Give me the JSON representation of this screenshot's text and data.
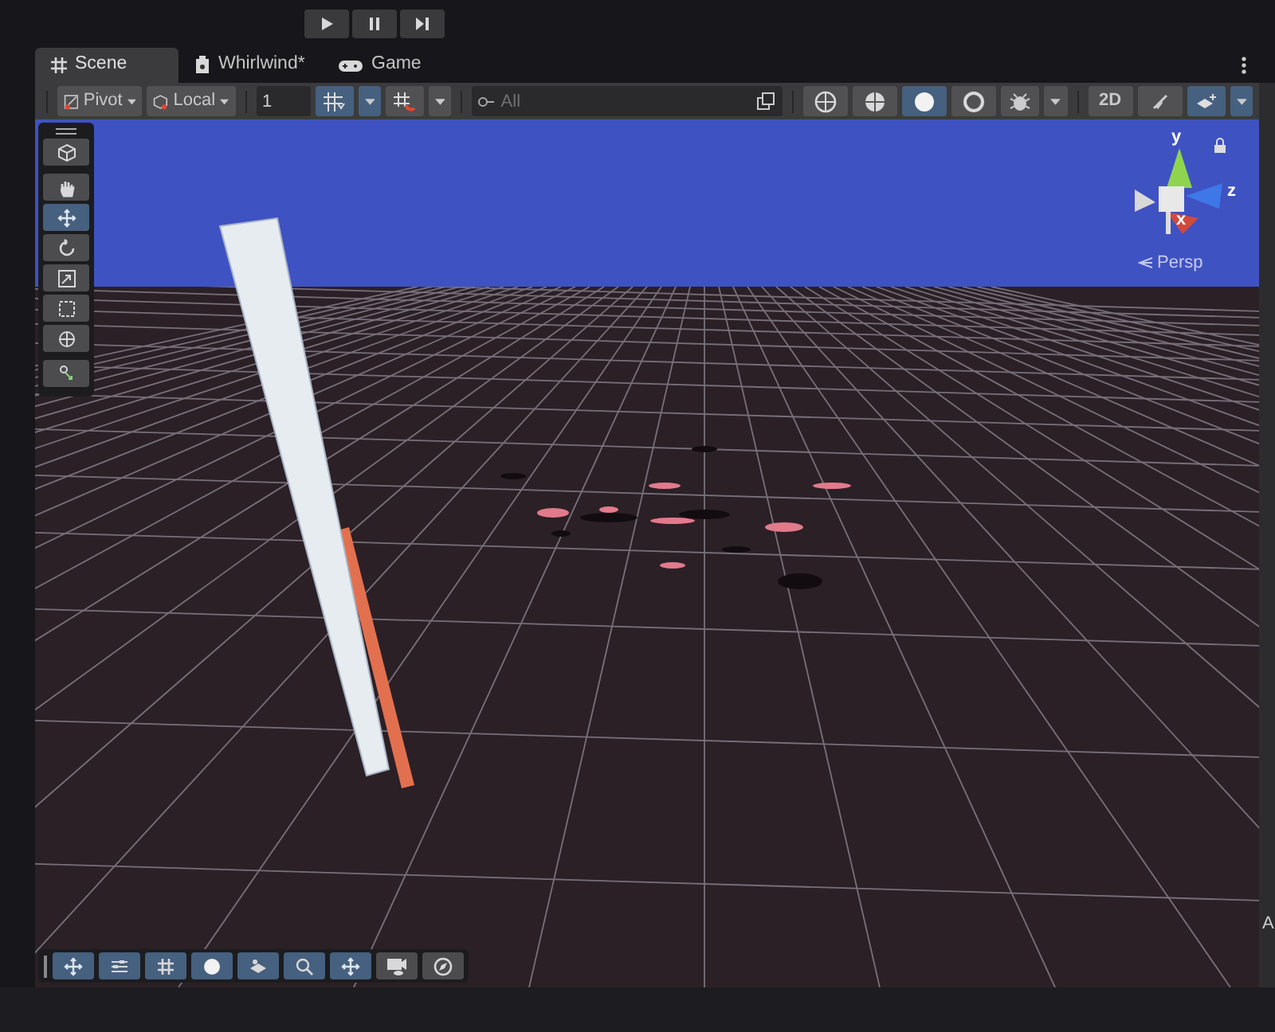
{
  "play_controls": [
    {
      "kind": "play",
      "on": false
    },
    {
      "kind": "pause",
      "on": false
    },
    {
      "kind": "step",
      "on": false
    }
  ],
  "tabs": [
    {
      "label": "Scene",
      "kind": "grid",
      "selected": true
    },
    {
      "label": "Whirlwind*",
      "kind": "prefab",
      "selected": false
    },
    {
      "label": "Game",
      "kind": "gamepad",
      "selected": false
    }
  ],
  "toolbar": {
    "pivot": "Pivot",
    "space": "Local",
    "snap_value": "1",
    "grid_snap_on": true,
    "increment_snap_on": false,
    "search": {
      "placeholder": "All"
    },
    "draw_modes": [
      {
        "kind": "wireframe",
        "selected": false
      },
      {
        "kind": "shaded-wireframe",
        "selected": false
      },
      {
        "kind": "shaded",
        "selected": true
      },
      {
        "kind": "unlit",
        "selected": false
      }
    ],
    "debug_on": false,
    "mode_2d": {
      "label": "2D",
      "on": false
    },
    "effects_on": false,
    "gizmos_on": true
  },
  "tools": [
    {
      "kind": "view",
      "selected": false
    },
    {
      "kind": "hand",
      "selected": false
    },
    {
      "kind": "move",
      "selected": true
    },
    {
      "kind": "rotate",
      "selected": false
    },
    {
      "kind": "scale",
      "selected": false
    },
    {
      "kind": "rect",
      "selected": false
    },
    {
      "kind": "transform",
      "selected": false
    },
    {
      "kind": "custom",
      "selected": false
    }
  ],
  "gizmo": {
    "axes": [
      {
        "label": "y"
      },
      {
        "label": "z"
      },
      {
        "label": "x"
      }
    ],
    "projection": "Persp"
  },
  "overlay_toolbar": [
    {
      "kind": "move",
      "on": true
    },
    {
      "kind": "sliders",
      "on": true
    },
    {
      "kind": "grid",
      "on": true
    },
    {
      "kind": "sphere",
      "on": true
    },
    {
      "kind": "plane",
      "on": true
    },
    {
      "kind": "search",
      "on": true
    },
    {
      "kind": "move",
      "on": true
    },
    {
      "kind": "camera",
      "on": false
    },
    {
      "kind": "compass",
      "on": false
    }
  ],
  "side_panel": {
    "label": "A"
  }
}
